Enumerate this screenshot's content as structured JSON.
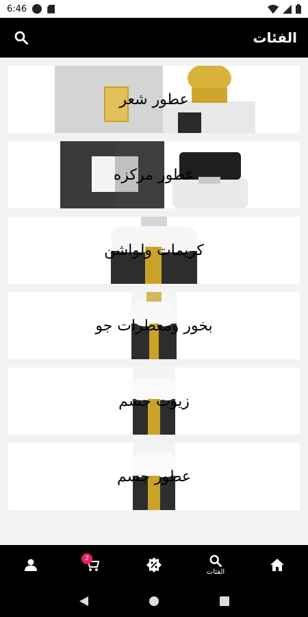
{
  "status_bar": {
    "time": "6:46"
  },
  "header": {
    "title": "الفئات",
    "search_icon": "search-icon"
  },
  "categories": [
    {
      "label": "عطور شعر"
    },
    {
      "label": "عطور مركزه"
    },
    {
      "label": "كريمات ولواشن"
    },
    {
      "label": "بخور ومعطرات جو"
    },
    {
      "label": "زيوت جسم"
    },
    {
      "label": "عطور جسم"
    }
  ],
  "bottom_nav": {
    "items": [
      {
        "icon": "person-icon",
        "label": ""
      },
      {
        "icon": "cart-icon",
        "label": "",
        "badge": "2"
      },
      {
        "icon": "offers-badge-icon",
        "label": ""
      },
      {
        "icon": "search-icon",
        "label": "الفئات"
      },
      {
        "icon": "home-icon",
        "label": ""
      }
    ]
  },
  "colors": {
    "accent": "#e91e63",
    "bar": "#000000",
    "background": "#f2f2f2"
  }
}
